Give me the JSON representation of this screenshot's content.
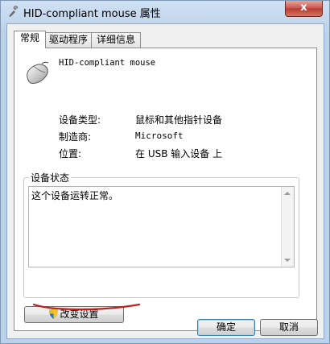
{
  "window": {
    "title": "HID-compliant mouse 属性",
    "close_label": "x"
  },
  "tabs": [
    {
      "label": "常规",
      "active": true
    },
    {
      "label": "驱动程序",
      "active": false
    },
    {
      "label": "详细信息",
      "active": false
    }
  ],
  "device": {
    "icon": "mouse-icon",
    "name": "HID-compliant mouse"
  },
  "properties": [
    {
      "label": "设备类型:",
      "value": "鼠标和其他指针设备"
    },
    {
      "label": "制造商:",
      "value": "Microsoft"
    },
    {
      "label": "位置:",
      "value": "在 USB 输入设备 上"
    }
  ],
  "status": {
    "group_title": "设备状态",
    "text": "这个设备运转正常。"
  },
  "buttons": {
    "change_settings": "改变设置",
    "ok": "确定",
    "cancel": "取消"
  },
  "colors": {
    "annotation_underline": "#c0201c",
    "close_button": "#c75050",
    "frame": "#bcd2ea"
  }
}
